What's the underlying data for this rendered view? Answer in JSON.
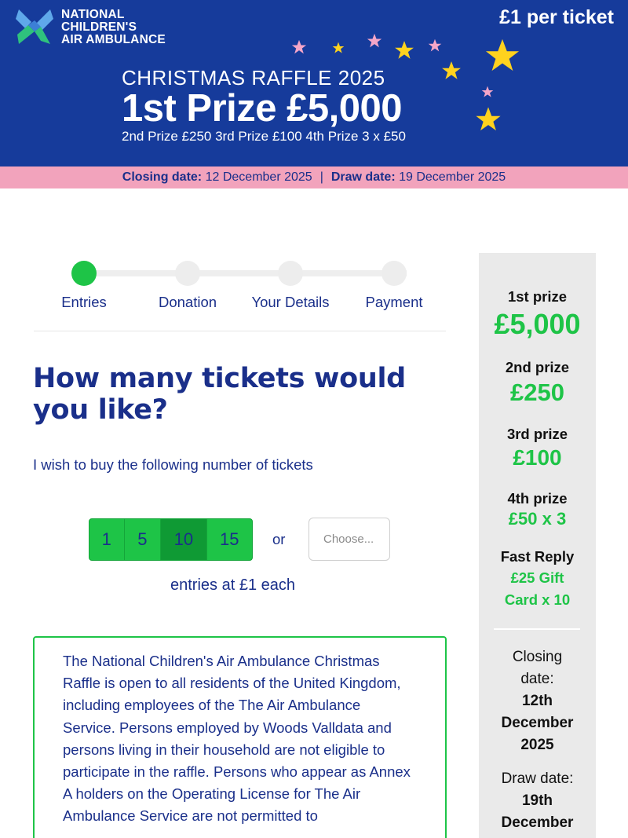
{
  "header": {
    "logo_lines": [
      "NATIONAL",
      "CHILDREN'S",
      "AIR AMBULANCE"
    ],
    "price": "£1 per ticket",
    "raffle_title": "CHRISTMAS RAFFLE 2025",
    "first_prize": "1st Prize £5,000",
    "other_prizes": "2nd Prize £250  3rd Prize  £100  4th Prize 3 x £50",
    "closing_label": "Closing date:",
    "closing_value": "12 December 2025",
    "separator": "|",
    "draw_label": "Draw date:",
    "draw_value": "19 December 2025",
    "colors": {
      "navy": "#163b9b",
      "pink": "#f2a3bc",
      "green": "#1ec447",
      "star_yellow": "#ffd21e",
      "star_pink": "#f5a6c8"
    }
  },
  "steps": {
    "items": [
      {
        "label": "Entries",
        "active": true
      },
      {
        "label": "Donation",
        "active": false
      },
      {
        "label": "Your Details",
        "active": false
      },
      {
        "label": "Payment",
        "active": false
      }
    ]
  },
  "main": {
    "question": "How many tickets would you like?",
    "instruction": "I wish to buy the following number of tickets",
    "ticket_options": [
      "1",
      "5",
      "10",
      "15"
    ],
    "selected_option": "10",
    "or_text": "or",
    "choose_placeholder": "Choose...",
    "each_text": "entries at £1 each",
    "terms": "The National Children's Air Ambulance Christmas Raffle is open to all residents of the United Kingdom, including employees of the The Air Ambulance Service. Persons employed by Woods Valldata and persons living in their household are not eligible to participate in the raffle. Persons who appear as Annex A holders on the Operating License for The Air Ambulance Service are not permitted to"
  },
  "sidebar": {
    "prizes": [
      {
        "label": "1st prize",
        "value": "£5,000"
      },
      {
        "label": "2nd prize",
        "value": "£250"
      },
      {
        "label": "3rd prize",
        "value": "£100"
      },
      {
        "label": "4th prize",
        "value": "£50 x 3"
      }
    ],
    "fast_reply_label": "Fast Reply",
    "fast_reply_value_line1": "£25 Gift",
    "fast_reply_value_line2": "Card x 10",
    "closing_label_line1": "Closing",
    "closing_label_line2": "date:",
    "closing_value_line1": "12th",
    "closing_value_line2": "December",
    "closing_value_line3": "2025",
    "draw_label": "Draw date:",
    "draw_value_line1": "19th",
    "draw_value_line2": "December"
  }
}
